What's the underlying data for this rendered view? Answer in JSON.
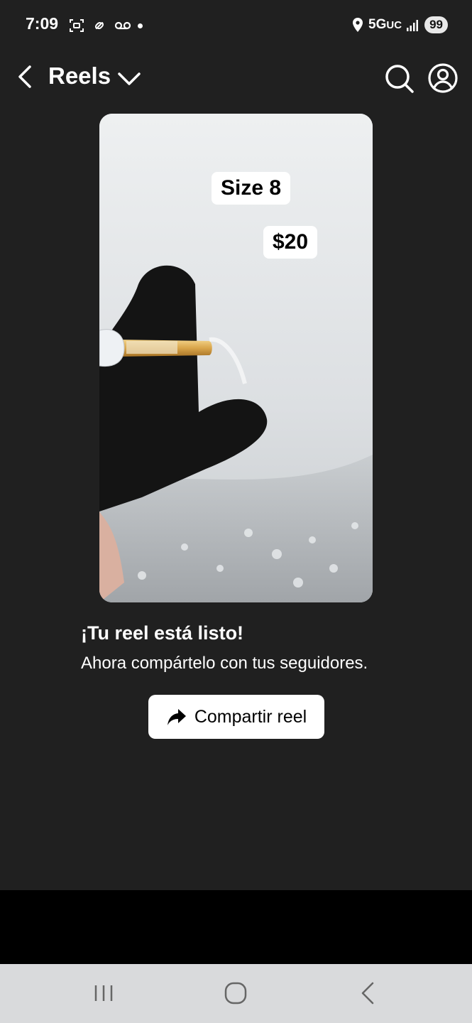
{
  "status_bar": {
    "time": "7:09",
    "network": "5G",
    "network_sub": "UC",
    "battery": "99"
  },
  "header": {
    "title": "Reels"
  },
  "preview": {
    "sticker_size": "Size 8",
    "sticker_price": "$20"
  },
  "message": {
    "title": "¡Tu reel está listo!",
    "subtitle": "Ahora compártelo con tus seguidores."
  },
  "actions": {
    "share_label": "Compartir reel"
  },
  "icons": {
    "back": "chevron-left-icon",
    "dropdown": "chevron-down-icon",
    "search": "search-icon",
    "profile": "profile-icon",
    "share": "share-arrow-icon"
  }
}
